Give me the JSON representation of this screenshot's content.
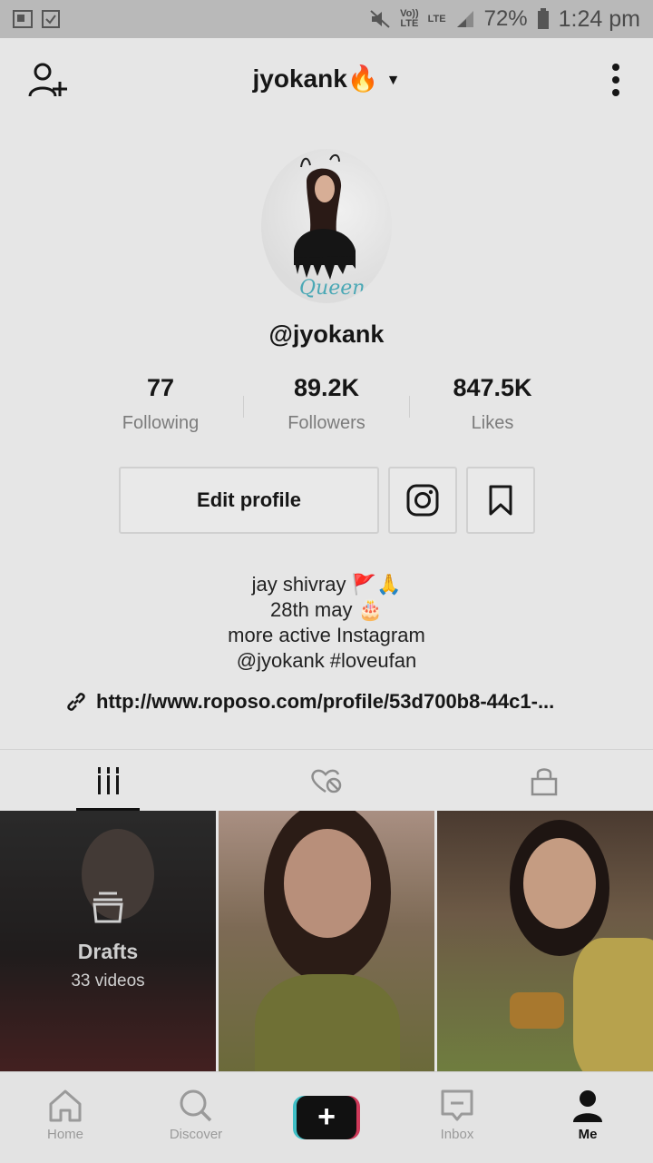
{
  "status_bar": {
    "network_top": "Vo))",
    "network_bottom": "LTE",
    "lte": "LTE",
    "battery": "72%",
    "time": "1:24 pm"
  },
  "header": {
    "username": "jyokank🔥",
    "caret": "▼"
  },
  "profile": {
    "handle": "@jyokank",
    "avatar_text": "Queen",
    "stats": [
      {
        "value": "77",
        "label": "Following"
      },
      {
        "value": "89.2K",
        "label": "Followers"
      },
      {
        "value": "847.5K",
        "label": "Likes"
      }
    ],
    "edit_profile_label": "Edit profile",
    "bio_lines": [
      "jay shivray 🚩🙏",
      "28th may 🎂",
      "more active Instagram",
      "@jyokank #loveufan"
    ],
    "link": "http://www.roposo.com/profile/53d700b8-44c1-..."
  },
  "tabs": [
    {
      "name": "videos",
      "icon": "grid-icon",
      "active": true
    },
    {
      "name": "liked",
      "icon": "hidden-heart-icon",
      "active": false
    },
    {
      "name": "private",
      "icon": "lock-icon",
      "active": false
    }
  ],
  "drafts": {
    "title": "Drafts",
    "count": "33 videos"
  },
  "bottom_nav": [
    {
      "label": "Home",
      "icon": "home-icon"
    },
    {
      "label": "Discover",
      "icon": "search-icon"
    },
    {
      "label": "",
      "icon": "plus-icon"
    },
    {
      "label": "Inbox",
      "icon": "inbox-icon"
    },
    {
      "label": "Me",
      "icon": "person-icon"
    }
  ],
  "colors": {
    "brand_cyan": "#3fbfc6",
    "brand_red": "#d03a5a",
    "text": "#161616",
    "muted": "#7c7c7c"
  }
}
